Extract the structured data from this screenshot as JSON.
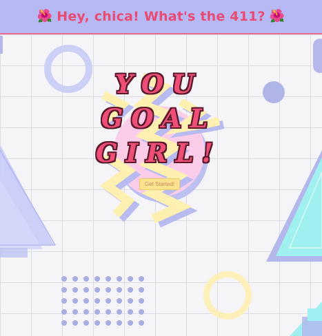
{
  "header": {
    "flower_left": "🌺",
    "title": "Hey, chica! What's the 411?",
    "flower_right": "🌺"
  },
  "hero": {
    "line1": "YOU",
    "line2": "GOAL",
    "line3": "GIRL!",
    "cta_label": "Get Started!"
  },
  "colors": {
    "header_bg": "#b7b9f4",
    "header_text": "#e94b73",
    "headline": "#ef4f76",
    "pink_circle": "#fccde9",
    "zigzag": "#fdf0b0",
    "triangle_blue": "#c8cbf6",
    "triangle_teal": "#9ff0ee",
    "button": "#fde38e"
  }
}
